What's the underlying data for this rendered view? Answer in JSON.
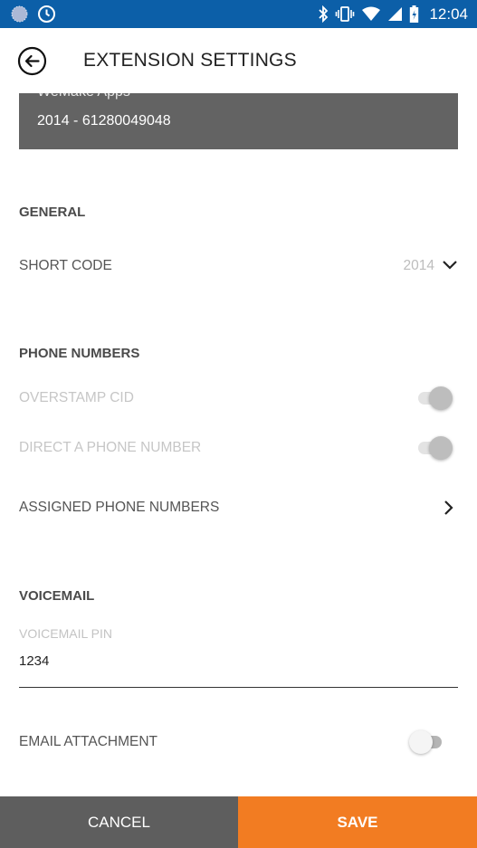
{
  "status_bar": {
    "time": "12:04",
    "left_icons": [
      "globe-icon",
      "clock-icon"
    ],
    "right_icons": [
      "bluetooth-icon",
      "vibrate-icon",
      "wifi-icon",
      "signal-icon",
      "battery-icon"
    ],
    "background": "#0c5fa8"
  },
  "app_bar": {
    "title": "EXTENSION SETTINGS",
    "back_icon": "back-arrow-icon"
  },
  "card": {
    "company": "WeMake Apps",
    "extension": "2014 - 61280049048",
    "background": "#636363"
  },
  "general": {
    "title": "GENERAL",
    "short_code": {
      "label": "SHORT CODE",
      "value": "2014"
    }
  },
  "phone_numbers": {
    "title": "PHONE NUMBERS",
    "overstamp_cid": {
      "label": "OVERSTAMP CID",
      "enabled": false,
      "checked": true
    },
    "direct_number": {
      "label": "DIRECT A PHONE NUMBER",
      "enabled": false,
      "checked": true
    },
    "assigned": {
      "label": "ASSIGNED PHONE NUMBERS"
    }
  },
  "voicemail": {
    "title": "VOICEMAIL",
    "pin_label": "VOICEMAIL PIN",
    "pin_value": "1234",
    "email_attachment": {
      "label": "EMAIL ATTACHMENT",
      "checked": false
    }
  },
  "actions": {
    "cancel_label": "CANCEL",
    "save_label": "SAVE",
    "save_color": "#f27c22",
    "cancel_color": "#5e5e5e"
  }
}
